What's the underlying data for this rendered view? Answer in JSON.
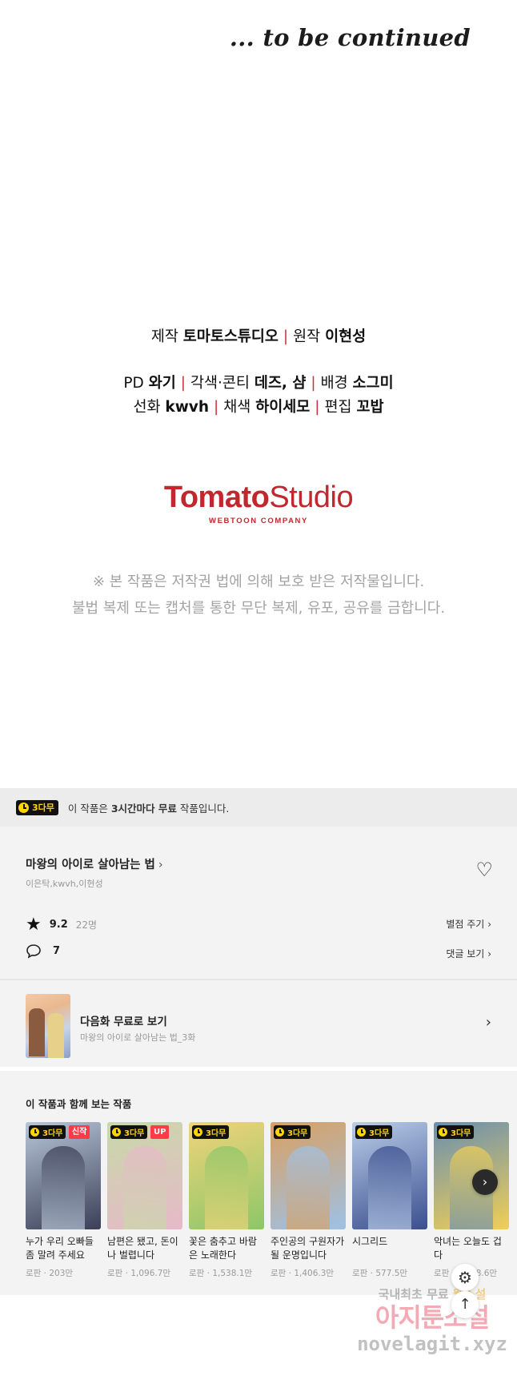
{
  "end_text": "... to be continued",
  "credits": {
    "production_label": "제작",
    "production_value": "토마토스튜디오",
    "original_label": "원작",
    "original_value": "이현성",
    "pd_label": "PD",
    "pd_value": "와기",
    "script_label": "각색·콘티",
    "script_value": "데즈, 샴",
    "background_label": "배경",
    "background_value": "소그미",
    "lineart_label": "선화",
    "lineart_value": "kwvh",
    "color_label": "채색",
    "color_value": "하이세모",
    "editor_label": "편집",
    "editor_value": "꼬밥"
  },
  "logo": {
    "word1": "Tomato",
    "word2": "Studio",
    "sub": "WEBTOON COMPANY"
  },
  "notice": {
    "line1": "※ 본 작품은 저작권 법에 의해 보호 받은 저작물입니다.",
    "line2": "불법 복제 또는 캡처를 통한 무단 복제, 유포, 공유를 금합니다."
  },
  "free_bar": {
    "badge": "3다무",
    "text_pre": "이 작품은 ",
    "text_bold": "3시간마다 무료",
    "text_post": " 작품입니다."
  },
  "work": {
    "title": "마왕의 아이로 살아남는 법",
    "authors": "이은탁,kwvh,이현성",
    "rating": "9.2",
    "rating_count": "22명",
    "rate_button": "별점 주기",
    "comment_count": "7",
    "comment_button": "댓글 보기"
  },
  "next_episode": {
    "title": "다음화 무료로 보기",
    "subtitle": "마왕의 아이로 살아남는 법_3화"
  },
  "recommendations": {
    "heading": "이 작품과 함께 보는 작품",
    "items": [
      {
        "badge": "3다무",
        "tag": "신작",
        "name": "누가 우리 오빠들 좀 말려 주세요",
        "meta": "로판 · 203만",
        "color1": "#3a3f57",
        "color2": "#b8c6d8"
      },
      {
        "badge": "3다무",
        "tag": "UP",
        "name": "남편은 됐고, 돈이나 벌렵니다",
        "meta": "로판 · 1,096.7만",
        "color1": "#e7b9c9",
        "color2": "#c7d9a8"
      },
      {
        "badge": "3다무",
        "tag": "",
        "name": "꽃은 춤추고 바람은 노래한다",
        "meta": "로판 · 1,538.1만",
        "color1": "#8cc768",
        "color2": "#f1d37a"
      },
      {
        "badge": "3다무",
        "tag": "",
        "name": "주인공의 구원자가 될 운명입니다",
        "meta": "로판 · 1,406.3만",
        "color1": "#9ec1e6",
        "color2": "#d9a062"
      },
      {
        "badge": "3다무",
        "tag": "",
        "name": "시그리드",
        "meta": "로판 · 577.5만",
        "color1": "#3b4f8f",
        "color2": "#b9cde8"
      },
      {
        "badge": "3다무",
        "tag": "",
        "name": "악녀는 오늘도 겁다",
        "meta": "로판 · 1,078.6만",
        "color1": "#f0cf55",
        "color2": "#6a8fb0"
      }
    ]
  },
  "watermark": {
    "line1_a": "국내최초 무료",
    "line1_b": "웹소설",
    "line2": "아지툰소설",
    "line3": "novelagit.xyz"
  }
}
